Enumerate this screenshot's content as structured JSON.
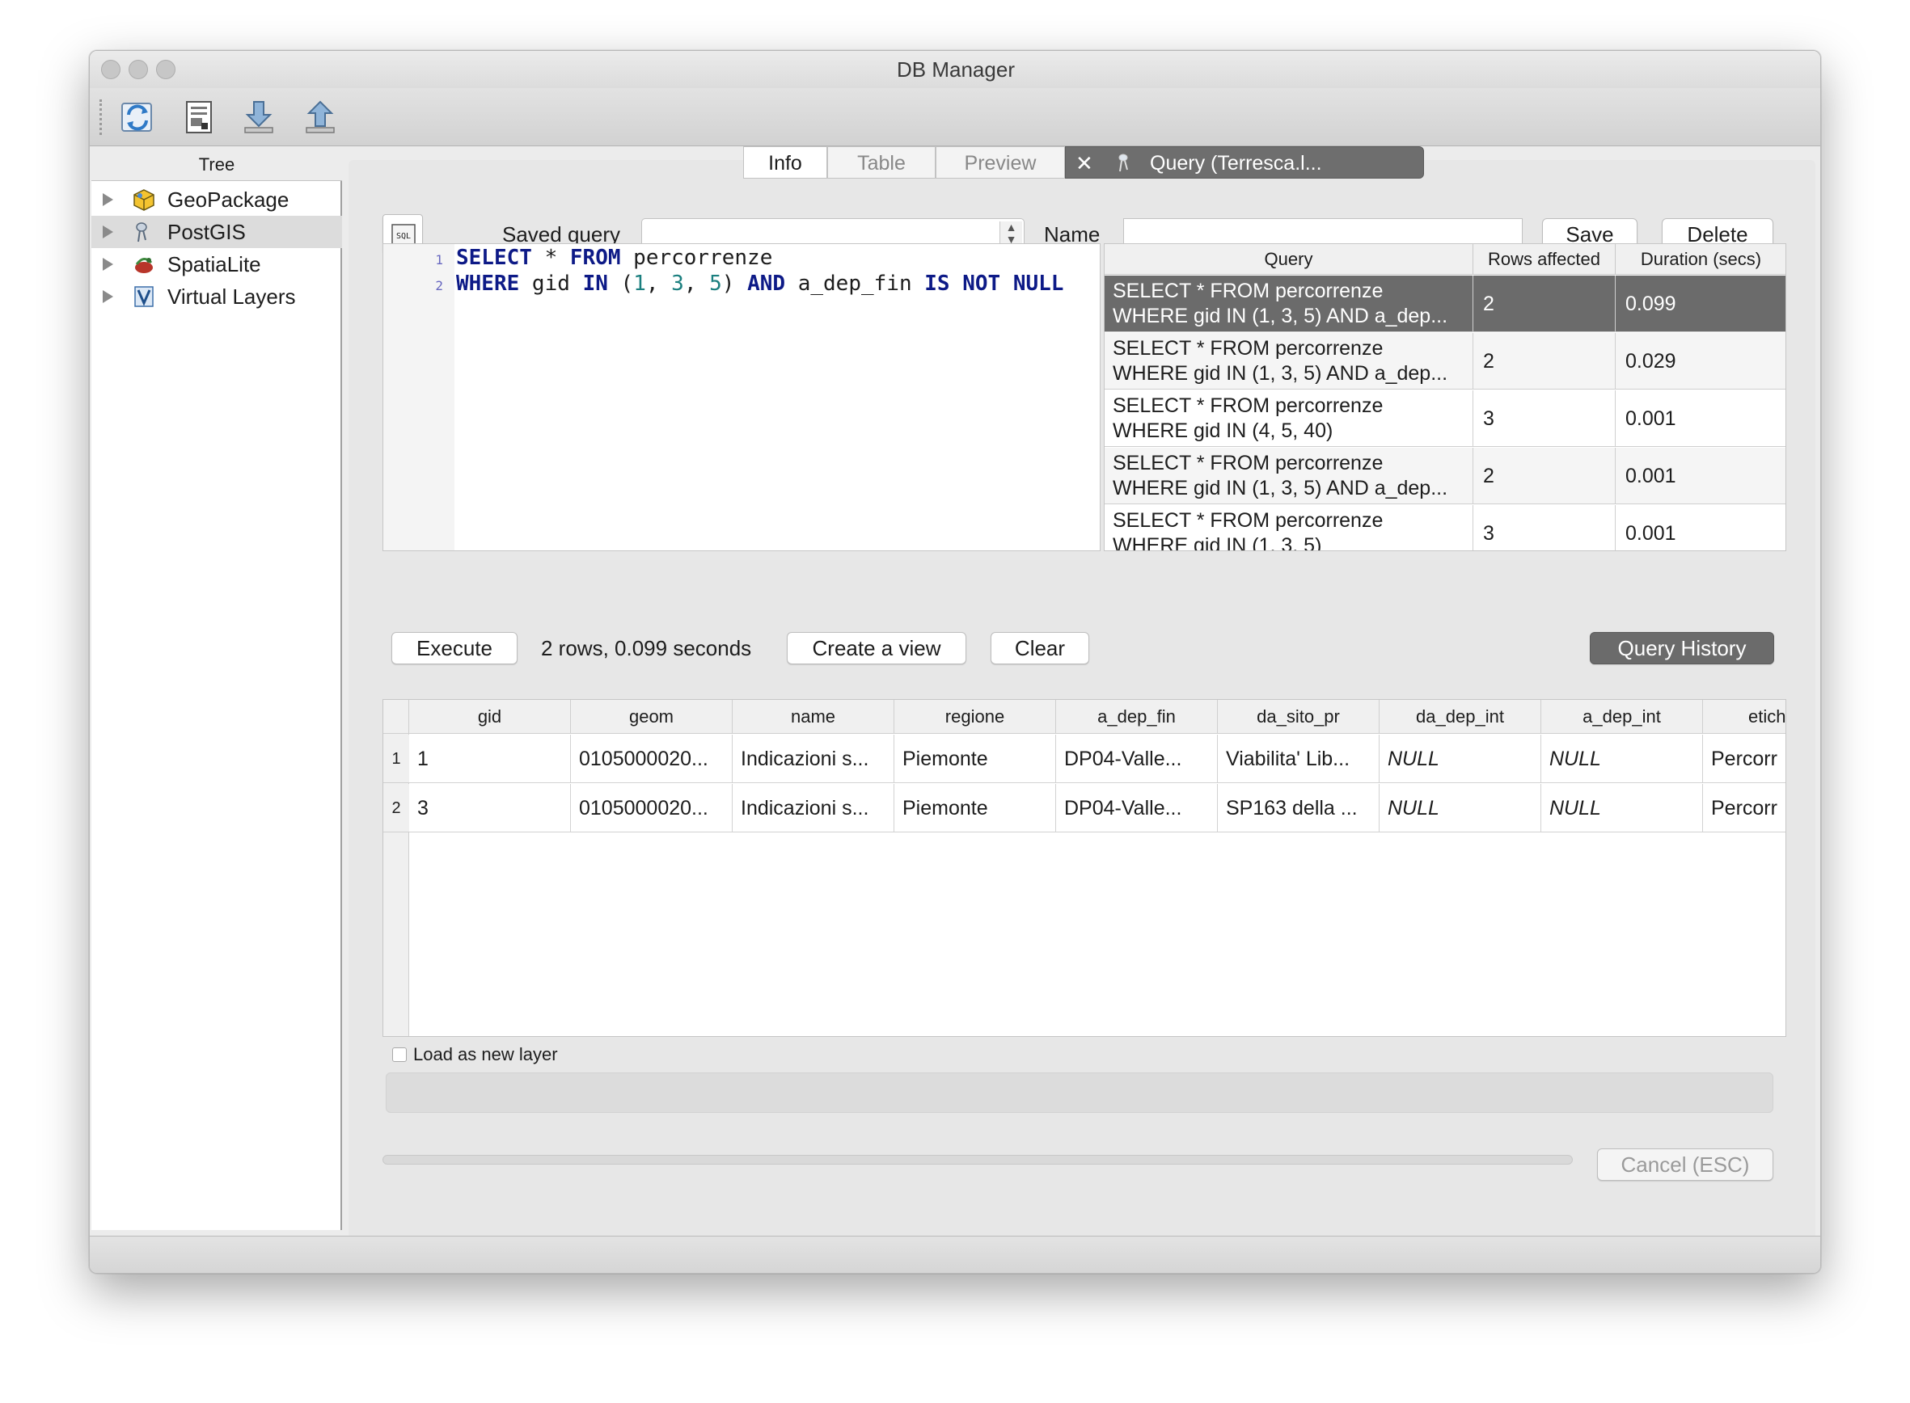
{
  "window": {
    "title": "DB Manager"
  },
  "toolbar": {
    "icons": [
      "refresh-icon",
      "sql-window-icon",
      "import-layer-icon",
      "export-icon"
    ]
  },
  "tree": {
    "header": "Tree",
    "items": [
      {
        "label": "GeoPackage",
        "icon": "geopackage-icon"
      },
      {
        "label": "PostGIS",
        "icon": "postgis-icon"
      },
      {
        "label": "SpatiaLite",
        "icon": "spatialite-icon"
      },
      {
        "label": "Virtual Layers",
        "icon": "virtual-layers-icon"
      }
    ]
  },
  "tabs": {
    "info": "Info",
    "table": "Table",
    "preview": "Preview",
    "query": "Query (Terresca.l..."
  },
  "query_bar": {
    "saved_query_label": "Saved query",
    "saved_query_value": "",
    "name_label": "Name",
    "name_value": "",
    "save": "Save",
    "delete": "Delete"
  },
  "editor": {
    "line_numbers": [
      "1",
      "2"
    ],
    "line1": {
      "t1": "SELECT",
      "t2": " * ",
      "t3": "FROM",
      "t4": " percorrenze"
    },
    "line2": {
      "t1": "WHERE",
      "t2": " gid ",
      "t3": "IN",
      "t4": " (",
      "t5": "1",
      "t6": ", ",
      "t7": "3",
      "t8": ", ",
      "t9": "5",
      "t10": ") ",
      "t11": "AND",
      "t12": " a_dep_fin ",
      "t13": "IS NOT NULL"
    }
  },
  "history": {
    "headers": [
      "Query",
      "Rows affected",
      "Duration (secs)"
    ],
    "rows": [
      {
        "q1": "SELECT * FROM percorrenze",
        "q2": "WHERE gid IN (1, 3, 5) AND a_dep...",
        "rows": "2",
        "dur": "0.099"
      },
      {
        "q1": "SELECT * FROM percorrenze",
        "q2": "WHERE gid IN (1, 3, 5) AND a_dep...",
        "rows": "2",
        "dur": "0.029"
      },
      {
        "q1": "SELECT * FROM percorrenze",
        "q2": "WHERE gid IN (4, 5, 40)",
        "rows": "3",
        "dur": "0.001"
      },
      {
        "q1": "SELECT * FROM percorrenze",
        "q2": "WHERE gid IN (1, 3, 5) AND a_dep...",
        "rows": "2",
        "dur": "0.001"
      },
      {
        "q1": "SELECT * FROM percorrenze",
        "q2": "WHERE gid IN (1, 3, 5)",
        "rows": "3",
        "dur": "0.001"
      }
    ]
  },
  "actions": {
    "execute": "Execute",
    "status": "2 rows, 0.099 seconds",
    "create_view": "Create a view",
    "clear": "Clear",
    "query_history": "Query History"
  },
  "results": {
    "columns": [
      "gid",
      "geom",
      "name",
      "regione",
      "a_dep_fin",
      "da_sito_pr",
      "da_dep_int",
      "a_dep_int",
      "etich"
    ],
    "row_numbers": [
      "1",
      "2"
    ],
    "rows": [
      [
        "1",
        "0105000020...",
        "Indicazioni s...",
        "Piemonte",
        "DP04-Valle...",
        "Viabilita' Lib...",
        "NULL",
        "NULL",
        "Percorr"
      ],
      [
        "3",
        "0105000020...",
        "Indicazioni s...",
        "Piemonte",
        "DP04-Valle...",
        "SP163 della ...",
        "NULL",
        "NULL",
        "Percorr"
      ]
    ]
  },
  "options": {
    "load_as_layer": "Load as new layer",
    "load_as_layer_checked": false
  },
  "progress": {
    "value": 0,
    "cancel": "Cancel (ESC)"
  }
}
